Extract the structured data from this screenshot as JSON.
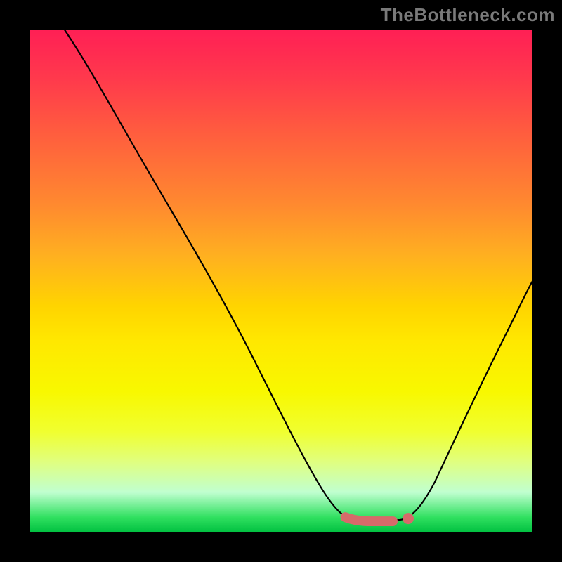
{
  "watermark": "TheBottleneck.com",
  "chart_data": {
    "type": "line",
    "title": "",
    "xlabel": "",
    "ylabel": "",
    "xlim": [
      0,
      100
    ],
    "ylim": [
      0,
      100
    ],
    "grid": false,
    "legend": false,
    "background_gradient": {
      "top_color": "#ff1f55",
      "bottom_color": "#00c040",
      "stops": [
        "#ff1f55",
        "#ff3a4c",
        "#ff5b3f",
        "#ff8a2f",
        "#ffb020",
        "#ffd400",
        "#ffe800",
        "#f8f800",
        "#f0ff30",
        "#e0ff80",
        "#c0ffd0",
        "#30e060",
        "#00c040"
      ]
    },
    "series": [
      {
        "name": "bottleneck-curve",
        "x": [
          7,
          15,
          25,
          35,
          45,
          55,
          60,
          62,
          66,
          70,
          74,
          75,
          80,
          85,
          90,
          95,
          100
        ],
        "y": [
          100,
          88,
          72,
          57,
          42,
          27,
          14,
          8,
          2.5,
          2,
          2,
          2.5,
          8,
          18,
          28,
          38,
          48
        ],
        "color": "#000000"
      }
    ],
    "annotations": [
      {
        "name": "bottom-dash-segment",
        "type": "segment",
        "x1": 62,
        "y1": 2.5,
        "x2": 74,
        "y2": 2.5,
        "color": "#d76a6a"
      },
      {
        "name": "bottom-dot-marker",
        "type": "point",
        "x": 75,
        "y": 2.5,
        "color": "#d76a6a"
      }
    ]
  }
}
